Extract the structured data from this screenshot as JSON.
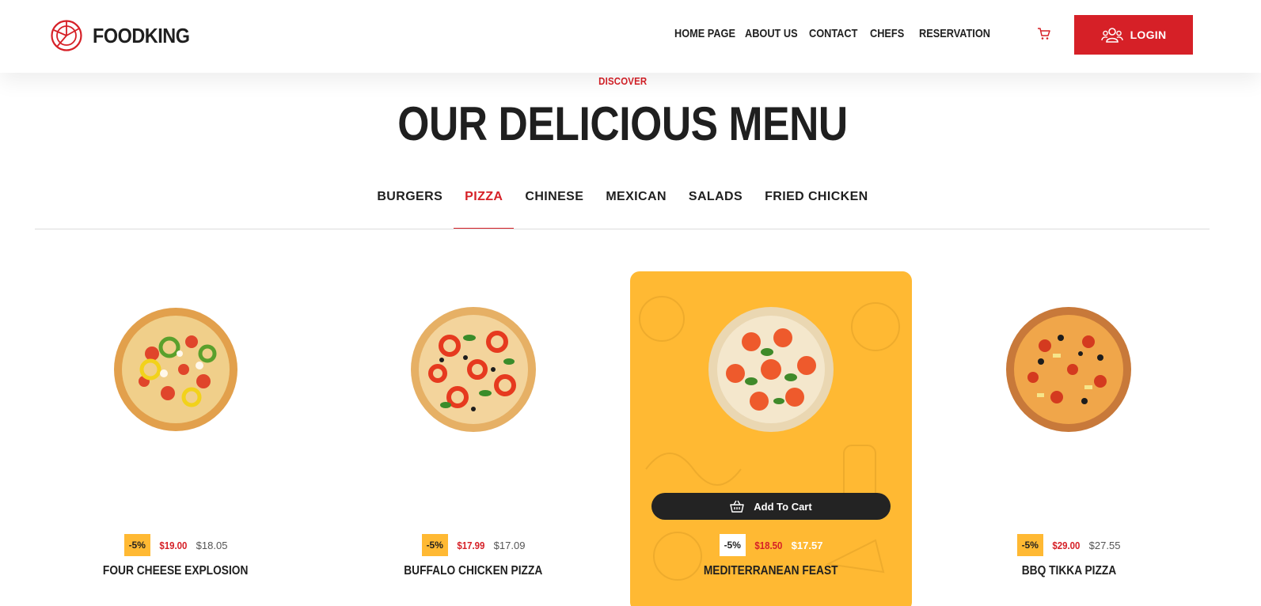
{
  "brand": {
    "name": "FOODKING"
  },
  "nav": {
    "items": [
      "HOME PAGE",
      "ABOUT US",
      "CONTACT",
      "CHEFS",
      "RESERVATION"
    ]
  },
  "header": {
    "login_label": "LOGIN"
  },
  "section": {
    "eyebrow": "DISCOVER",
    "title": "OUR DELICIOUS MENU"
  },
  "tabs": {
    "items": [
      "BURGERS",
      "PIZZA",
      "CHINESE",
      "MEXICAN",
      "SALADS",
      "FRIED CHICKEN"
    ],
    "active": "PIZZA"
  },
  "products": [
    {
      "name": "FOUR CHEESE EXPLOSION",
      "discount": "-5%",
      "price": "$19.00",
      "old_price": "$18.05"
    },
    {
      "name": "BUFFALO CHICKEN PIZZA",
      "discount": "-5%",
      "price": "$17.99",
      "old_price": "$17.09"
    },
    {
      "name": "MEDITERRANEAN FEAST",
      "discount": "-5%",
      "price": "$18.50",
      "old_price": "$17.57",
      "add_to_cart": "Add To Cart"
    },
    {
      "name": "BBQ TIKKA PIZZA",
      "discount": "-5%",
      "price": "$29.00",
      "old_price": "$27.55"
    }
  ],
  "colors": {
    "accent": "#d62027",
    "highlight": "#ffb933",
    "dark": "#232323"
  },
  "icons": {
    "logo": "pizza-slice-icon",
    "cart": "cart-icon",
    "login": "users-icon",
    "add_to_cart": "basket-icon"
  }
}
